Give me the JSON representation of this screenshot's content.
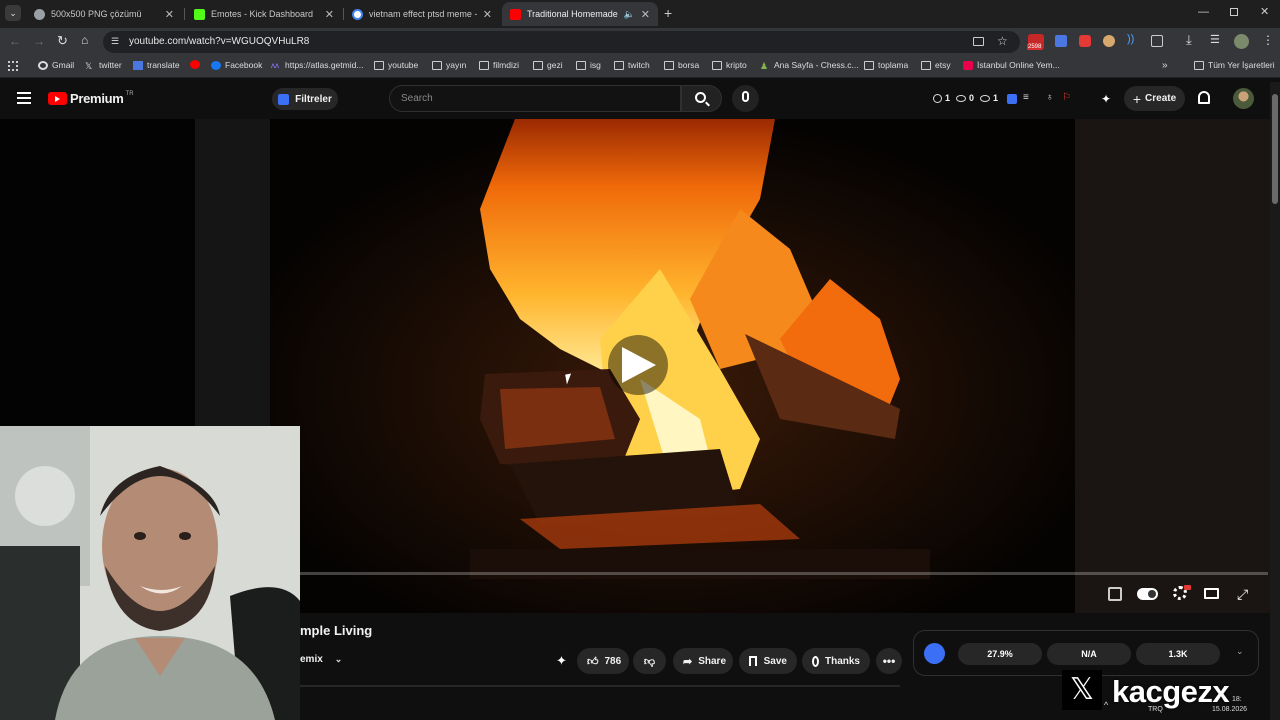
{
  "tabs": [
    {
      "title": "500x500 PNG çözümü",
      "active": false
    },
    {
      "title": "Emotes - Kick Dashboard",
      "active": false
    },
    {
      "title": "vietnam effect ptsd meme - Go",
      "active": false
    },
    {
      "title": "Traditional Homemade Las",
      "active": true
    }
  ],
  "address": {
    "url": "youtube.com/watch?v=WGUOQVHuLR8",
    "badge": "2598"
  },
  "bookmarks": [
    "Gmail",
    "twitter",
    "translate",
    "Facebook",
    "https://atlas.getmid...",
    "youtube",
    "yayın",
    "filmdizi",
    "gezi",
    "isg",
    "twitch",
    "borsa",
    "kripto",
    "Ana Sayfa - Chess.c...",
    "toplama",
    "etsy",
    "İstanbul Online Yem..."
  ],
  "bookmarks_all": "Tüm Yer İşaretleri",
  "youtube": {
    "logo": "Premium",
    "logo_sup": "TR",
    "filter": "Filtreler",
    "search_placeholder": "Search",
    "counter_a": "1",
    "counter_b": "0",
    "counter_c": "1",
    "create": "Create"
  },
  "video": {
    "title_partial": "mple Living",
    "channel_partial": "emix",
    "likes": "786",
    "share": "Share",
    "save": "Save",
    "thanks": "Thanks",
    "progress": 0.0
  },
  "stats": {
    "a": "27.9%",
    "b": "N/A",
    "c": "1.3K"
  },
  "overlay": {
    "brand": "kacgezx"
  },
  "taskbar": {
    "lang": "TRQ",
    "date": "15.08.2026",
    "time": "18:"
  },
  "colors": {
    "yt_red": "#ff0000",
    "accent_blue": "#3ea6ff",
    "iq_blue": "#3b6ff5"
  }
}
